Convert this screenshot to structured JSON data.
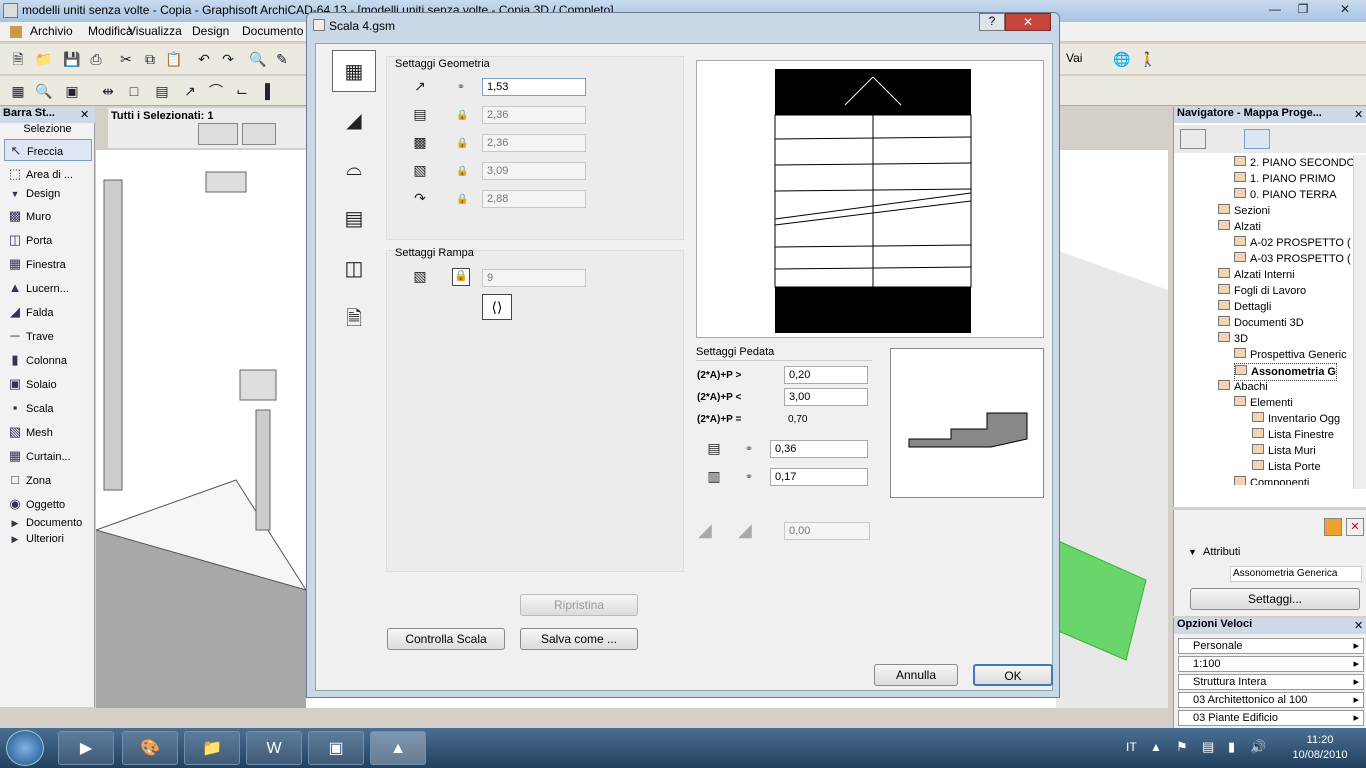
{
  "window": {
    "title": "modelli uniti senza volte - Copia - Graphisoft ArchiCAD-64 13 - [modelli uniti senza volte - Copia 3D / Completo]"
  },
  "menu": [
    "Archivio",
    "Modifica",
    "Visualizza",
    "Design",
    "Documento"
  ],
  "menu_right": "Vai",
  "toolbox": {
    "title": "Barra St...",
    "section_select": "Selezione",
    "freccia": "Freccia",
    "area": "Area di ...",
    "design_header": "Design",
    "tools": [
      "Muro",
      "Porta",
      "Finestra",
      "Lucern...",
      "Falda",
      "Trave",
      "Colonna",
      "Solaio",
      "Scala",
      "Mesh",
      "Curtain...",
      "Zona",
      "Oggetto"
    ],
    "documento": "Documento",
    "ulteriori": "Ulteriori"
  },
  "info_box": {
    "selection": "Tutti i Selezionati: 1"
  },
  "dialog": {
    "title": "Scala 4.gsm",
    "geometria": {
      "label": "Settaggi Geometria",
      "fields": [
        "1,53",
        "2,36",
        "2,36",
        "3,09",
        "2,88"
      ]
    },
    "rampa": {
      "label": "Settaggi Rampa",
      "value": "9"
    },
    "pedata": {
      "label": "Settaggi Pedata",
      "rows": [
        {
          "label": "(2*A)+P >",
          "value": "0,20"
        },
        {
          "label": "(2*A)+P <",
          "value": "3,00"
        },
        {
          "label": "(2*A)+P =",
          "value": "0,70"
        }
      ],
      "tread": "0,36",
      "riser": "0,17",
      "disabled_value": "0,00"
    },
    "buttons": {
      "ripristina": "Ripristina",
      "controlla": "Controlla Scala",
      "salva": "Salva come ...",
      "annulla": "Annulla",
      "ok": "OK"
    }
  },
  "navigator": {
    "title": "Navigatore - Mappa Proge...",
    "items": [
      "2. PIANO SECONDO",
      "1. PIANO PRIMO",
      "0. PIANO TERRA",
      "Sezioni",
      "Alzati",
      "A-02 PROSPETTO (",
      "A-03 PROSPETTO (",
      "Alzati Interni",
      "Fogli di Lavoro",
      "Dettagli",
      "Documenti 3D",
      "3D",
      "Prospettiva Generic",
      "Assonometria G",
      "Abachi",
      "Elementi",
      "Inventario Ogg",
      "Lista Finestre",
      "Lista Muri",
      "Lista Porte",
      "Componenti"
    ],
    "attributi_label": "Attributi",
    "attributi_value": "Assonometria Generica",
    "settaggi_button": "Settaggi..."
  },
  "opzioni": {
    "title": "Opzioni Veloci",
    "rows": [
      "Personale",
      "1:100",
      "Struttura Intera",
      "03 Architettonico al 100",
      "03 Piante Edificio"
    ]
  },
  "taskbar": {
    "lang": "IT",
    "time": "11:20",
    "date": "10/08/2010"
  }
}
